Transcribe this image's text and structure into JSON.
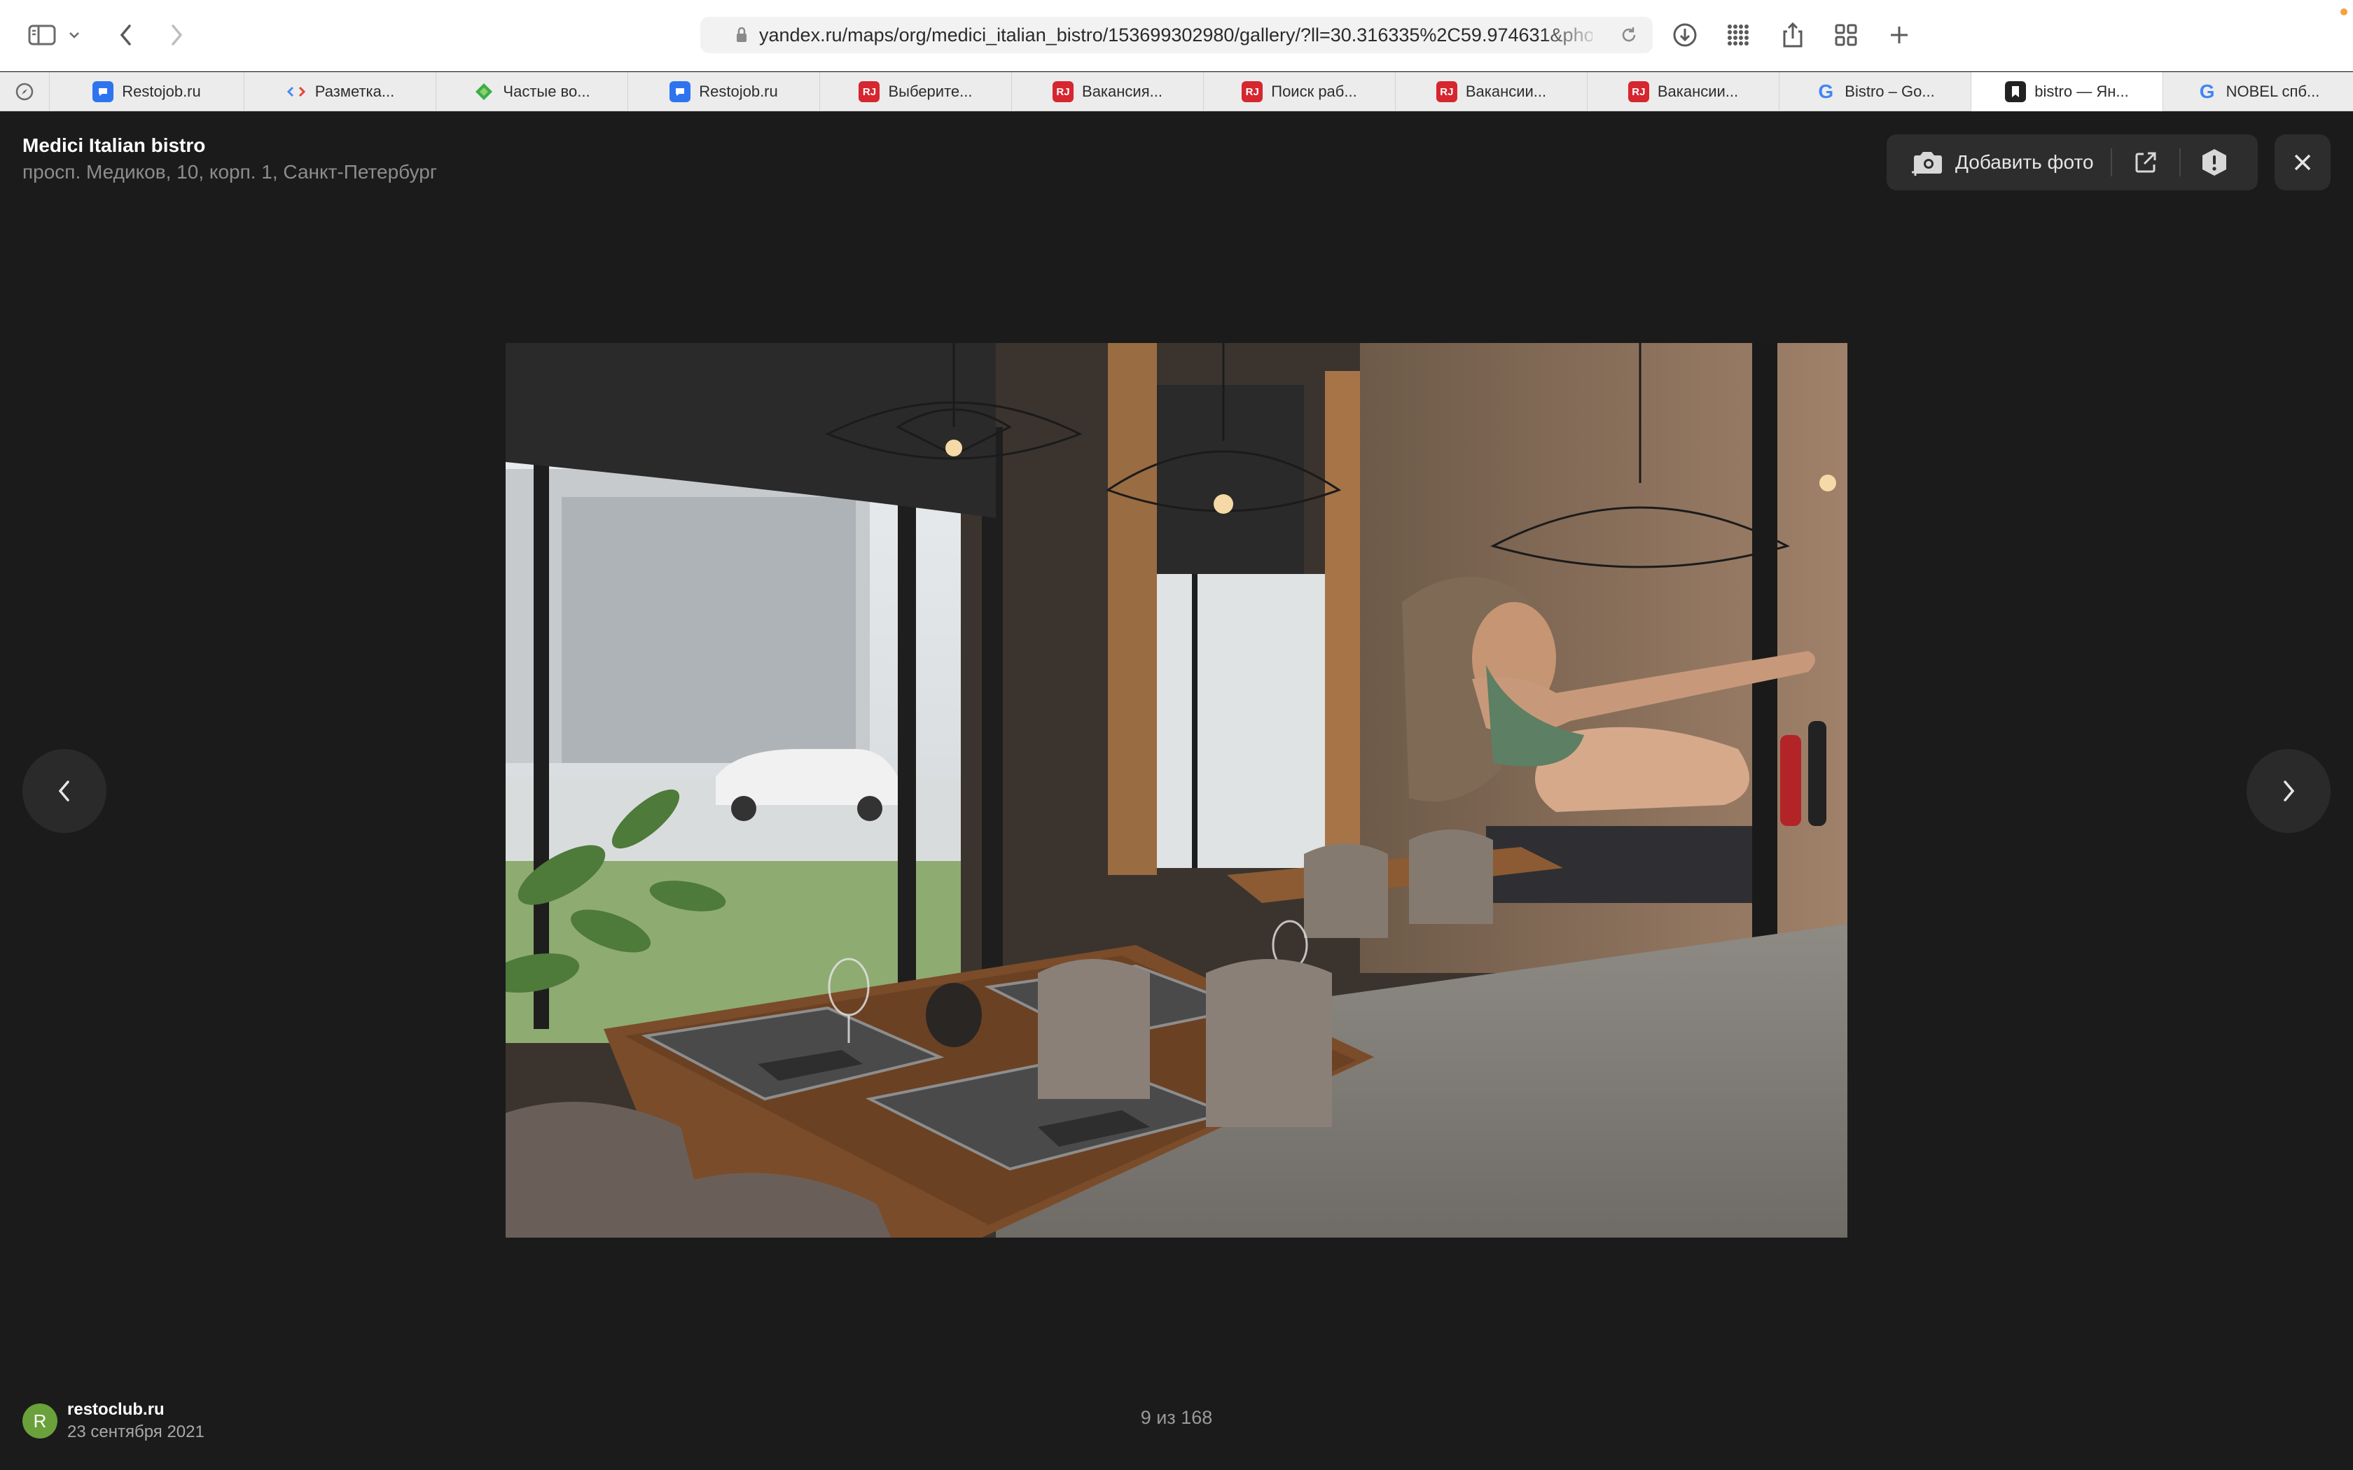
{
  "browser": {
    "url": "yandex.ru/maps/org/medici_italian_bistro/153699302980/gallery/?ll=30.316335%2C59.974631&pho",
    "accent_dot_color": "#f3a33a"
  },
  "tabs": [
    {
      "label": "Restojob.ru",
      "icon": "chat-bubble-icon"
    },
    {
      "label": "Разметка...",
      "icon": "code-brackets-icon"
    },
    {
      "label": "Частые во...",
      "icon": "green-diamond-icon"
    },
    {
      "label": "Restojob.ru",
      "icon": "chat-bubble-icon"
    },
    {
      "label": "Выберите...",
      "icon": "rj-icon",
      "badge": "RJ"
    },
    {
      "label": "Вакансия...",
      "icon": "rj-icon",
      "badge": "RJ"
    },
    {
      "label": "Поиск раб...",
      "icon": "rj-icon",
      "badge": "RJ"
    },
    {
      "label": "Вакансии...",
      "icon": "rj-icon",
      "badge": "RJ"
    },
    {
      "label": "Вакансии...",
      "icon": "rj-icon",
      "badge": "RJ"
    },
    {
      "label": "Bistro – Go...",
      "icon": "google-icon",
      "badge": "G"
    },
    {
      "label": "bistro — Ян...",
      "icon": "bookmark-icon",
      "active": true
    },
    {
      "label": "NOBEL спб...",
      "icon": "google-icon",
      "badge": "G"
    }
  ],
  "org": {
    "name": "Medici Italian bistro",
    "address": "просп. Медиков, 10, корп. 1, Санкт-Петербург"
  },
  "actions": {
    "add_photo_label": "Добавить фото"
  },
  "photo": {
    "description_icon": "restaurant-interior-photo"
  },
  "author": {
    "avatar_letter": "R",
    "avatar_color": "#6aa13b",
    "name": "restoclub.ru",
    "date": "23 сентября 2021"
  },
  "counter": "9 из 168"
}
